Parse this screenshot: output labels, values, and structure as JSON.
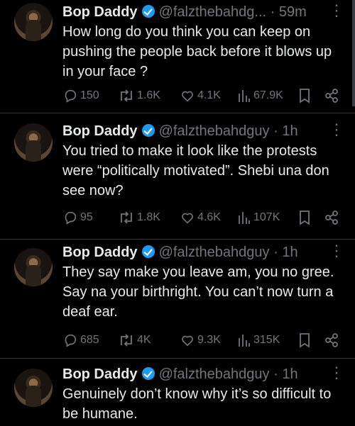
{
  "tweets": [
    {
      "name": "Bop Daddy",
      "handle": "@falzthebahdg...",
      "dot": "·",
      "time": "59m",
      "text": "How long do you think you can keep on pushing the people back before it blows up in your face ?",
      "replies": "150",
      "retweets": "1.6K",
      "likes": "4.1K",
      "views": "67.9K"
    },
    {
      "name": "Bop Daddy",
      "handle": "@falzthebahdguy",
      "dot": "·",
      "time": "1h",
      "text": "You tried to make it look like the protests were “politically motivated”. Shebi una don see now?",
      "replies": "95",
      "retweets": "1.8K",
      "likes": "4.6K",
      "views": "107K"
    },
    {
      "name": "Bop Daddy",
      "handle": "@falzthebahdguy",
      "dot": "·",
      "time": "1h",
      "text": "They say make you leave am, you no gree. Say na your birthright. You can’t now turn a deaf ear.",
      "replies": "685",
      "retweets": "4K",
      "likes": "9.3K",
      "views": "315K"
    },
    {
      "name": "Bop Daddy",
      "handle": "@falzthebahdguy",
      "dot": "·",
      "time": "1h",
      "text": "Genuinely don’t know why it’s so difficult to be humane."
    }
  ],
  "colors": {
    "background": "#000000",
    "text": "#e7e9ea",
    "muted": "#71767b",
    "verified": "#1d9bf0"
  },
  "icons": [
    "verified-badge-icon",
    "more-icon",
    "reply-icon",
    "retweet-icon",
    "like-icon",
    "views-icon",
    "bookmark-icon",
    "share-icon"
  ]
}
